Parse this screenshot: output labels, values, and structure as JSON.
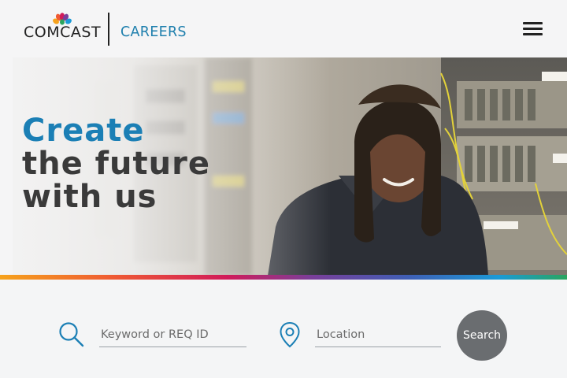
{
  "header": {
    "logo_text": "COMCAST",
    "careers_text": "CAREERS",
    "menu_icon": "hamburger-menu-icon",
    "brand_colors": [
      "#f6a21c",
      "#ef5a33",
      "#d11b5a",
      "#7a3e9a",
      "#1a9ad7",
      "#2aa55f"
    ]
  },
  "hero": {
    "line1": "Create",
    "line2": "the future",
    "line3": "with us",
    "accent_color": "#1b7fb5",
    "text_color": "#3a3a3a"
  },
  "search": {
    "keyword_placeholder": "Keyword or REQ ID",
    "keyword_icon": "search-icon",
    "location_placeholder": "Location",
    "location_icon": "location-pin-icon",
    "button_label": "Search",
    "button_color": "#6a6d70"
  }
}
